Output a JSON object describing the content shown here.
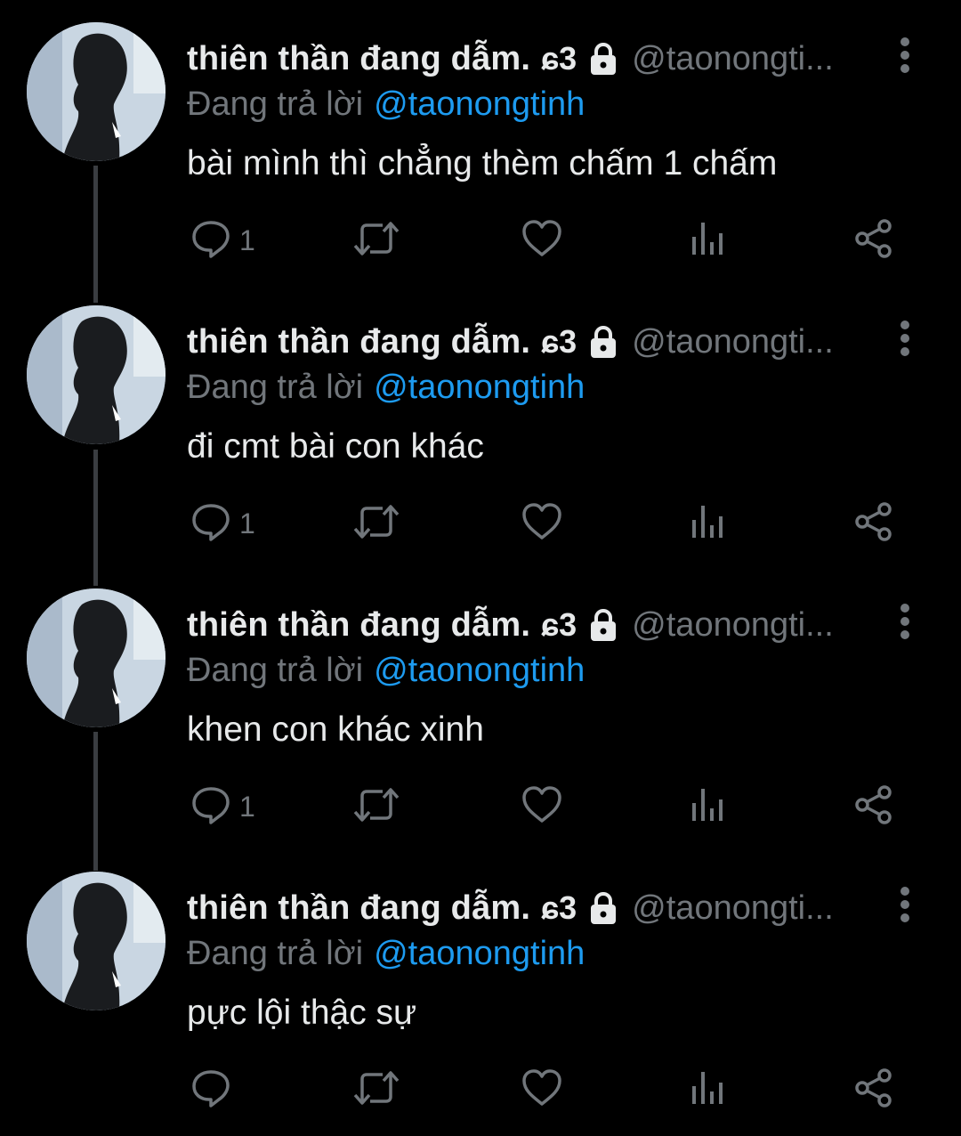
{
  "colors": {
    "background": "#000000",
    "text_primary": "#e7e9ea",
    "text_secondary": "#71767b",
    "mention_blue": "#1d9bf0",
    "thread_line": "#3a3d41"
  },
  "icons": {
    "reply": "speech-bubble-icon",
    "retweet": "retweet-arrows-icon",
    "like": "heart-outline-icon",
    "views": "bar-chart-icon",
    "share": "share-nodes-icon",
    "lock": "padlock-icon",
    "more": "vertical-dots-icon"
  },
  "tweets": [
    {
      "display_name": "thiên thần đang dẫm.",
      "badge": "ɕ3",
      "handle": "@taonongti...",
      "reply_prefix": "Đang trả lời",
      "reply_mention": "@taonongtinh",
      "text": "bài mình thì chẳng thèm chấm 1 chấm",
      "reply_count": "1"
    },
    {
      "display_name": "thiên thần đang dẫm.",
      "badge": "ɕ3",
      "handle": "@taonongti...",
      "reply_prefix": "Đang trả lời",
      "reply_mention": "@taonongtinh",
      "text": "đi cmt bài con khác",
      "reply_count": "1"
    },
    {
      "display_name": "thiên thần đang dẫm.",
      "badge": "ɕ3",
      "handle": "@taonongti...",
      "reply_prefix": "Đang trả lời",
      "reply_mention": "@taonongtinh",
      "text": "khen con khác xinh",
      "reply_count": "1"
    },
    {
      "display_name": "thiên thần đang dẫm.",
      "badge": "ɕ3",
      "handle": "@taonongti...",
      "reply_prefix": "Đang trả lời",
      "reply_mention": "@taonongtinh",
      "text": "pực lội thậc sự",
      "reply_count": ""
    }
  ]
}
